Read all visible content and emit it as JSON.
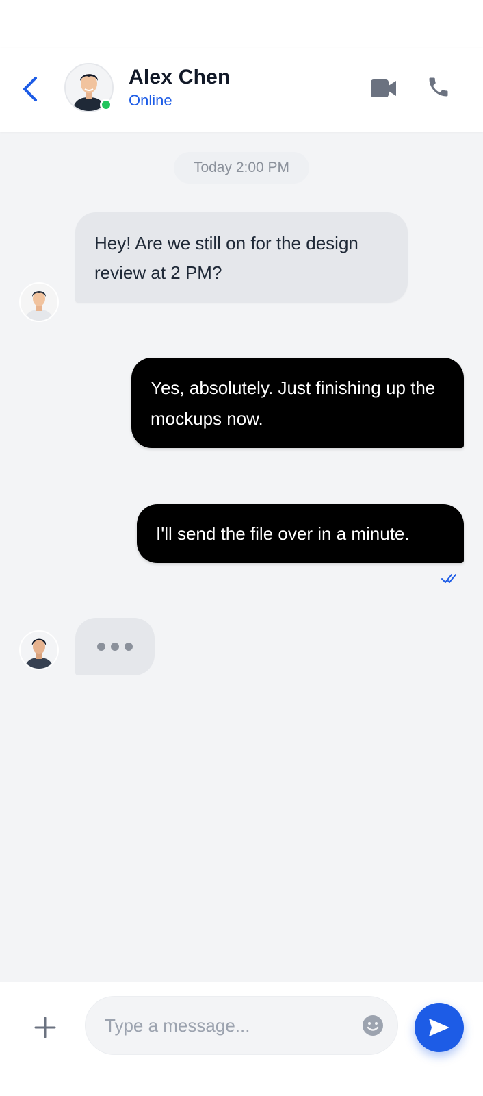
{
  "header": {
    "contact_name": "Alex Chen",
    "status": "Online",
    "back_icon": "chevron-left-icon",
    "video_icon": "video-camera-icon",
    "phone_icon": "phone-icon",
    "accent_color": "#1d5ce6",
    "online_color": "#22c55e"
  },
  "conversation": {
    "date_label": "Today 2:00 PM",
    "messages": [
      {
        "direction": "incoming",
        "text": "Hey! Are we still on for the design review at 2 PM?"
      },
      {
        "direction": "outgoing",
        "text": "Yes, absolutely. Just finishing up the mockups now."
      },
      {
        "direction": "outgoing",
        "text": "I'll send the file over in a minute.",
        "receipt": "read"
      }
    ],
    "typing_indicator": true
  },
  "composer": {
    "placeholder": "Type a message...",
    "value": "",
    "attach_icon": "plus-icon",
    "emoji_icon": "smiley-icon",
    "send_icon": "send-icon"
  }
}
